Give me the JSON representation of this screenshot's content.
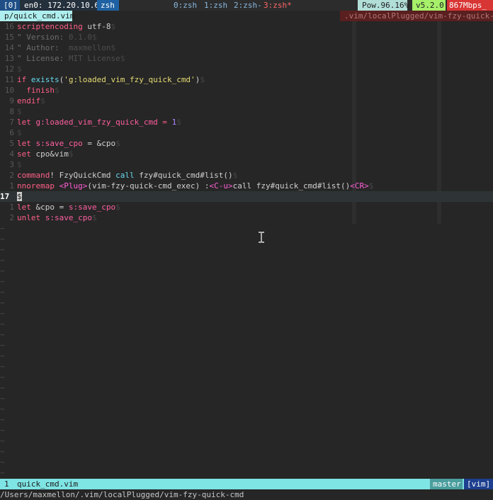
{
  "tmux": {
    "session": "[0]",
    "ip": "en0: 172.20.10.6",
    "current": "zsh",
    "windows": [
      "0:zsh",
      "1:zsh",
      "2:zsh-",
      "3:zsh*"
    ],
    "power": "Pow.96.16%",
    "version": "v5.2.0",
    "network": "867Mbps_"
  },
  "vim": {
    "tab_file": "p/quick_cmd.vim",
    "tab_path": ".vim/localPlugged/vim-fzy-quick-cde",
    "eol_char": "$",
    "tilde": "~",
    "lines": [
      {
        "num": "16",
        "tokens": [
          {
            "t": "scriptencoding ",
            "c": "kw"
          },
          {
            "t": "utf-8",
            "c": ""
          }
        ]
      },
      {
        "num": "15",
        "tokens": [
          {
            "t": "\" Version: ",
            "c": "cm"
          },
          {
            "t": "0.1.0",
            "c": "cmv"
          }
        ]
      },
      {
        "num": "14",
        "tokens": [
          {
            "t": "\" Author:  ",
            "c": "cm"
          },
          {
            "t": "maxmellon",
            "c": "cmv"
          }
        ]
      },
      {
        "num": "13",
        "tokens": [
          {
            "t": "\" License: ",
            "c": "cm"
          },
          {
            "t": "MIT License",
            "c": "cmv"
          }
        ]
      },
      {
        "num": "12",
        "tokens": []
      },
      {
        "num": "11",
        "tokens": [
          {
            "t": "if ",
            "c": "kw"
          },
          {
            "t": "exists",
            "c": "fn"
          },
          {
            "t": "(",
            "c": ""
          },
          {
            "t": "'g:loaded_vim_fzy_quick_cmd'",
            "c": "str"
          },
          {
            "t": ")",
            "c": ""
          }
        ]
      },
      {
        "num": "10",
        "tokens": [
          {
            "t": "  finish",
            "c": "kw"
          }
        ]
      },
      {
        "num": "9",
        "tokens": [
          {
            "t": "endif",
            "c": "kw"
          }
        ]
      },
      {
        "num": "8",
        "tokens": []
      },
      {
        "num": "7",
        "tokens": [
          {
            "t": "let ",
            "c": "kw"
          },
          {
            "t": "g:loaded_vim_fzy_quick_cmd",
            "c": "var"
          },
          {
            "t": " = ",
            "c": "kw"
          },
          {
            "t": "1",
            "c": "num"
          }
        ]
      },
      {
        "num": "6",
        "tokens": []
      },
      {
        "num": "5",
        "tokens": [
          {
            "t": "let ",
            "c": "kw"
          },
          {
            "t": "s:save_cpo",
            "c": "var"
          },
          {
            "t": " = &cpo",
            "c": ""
          }
        ]
      },
      {
        "num": "4",
        "tokens": [
          {
            "t": "set ",
            "c": "kw"
          },
          {
            "t": "cpo&vim",
            "c": ""
          }
        ]
      },
      {
        "num": "3",
        "tokens": []
      },
      {
        "num": "2",
        "tokens": [
          {
            "t": "command",
            "c": "kw"
          },
          {
            "t": "! FzyQuickCmd ",
            "c": ""
          },
          {
            "t": "call ",
            "c": "fn"
          },
          {
            "t": "fzy#quick_cmd#list()",
            "c": ""
          }
        ]
      },
      {
        "num": "1",
        "tokens": [
          {
            "t": "nnoremap ",
            "c": "kw"
          },
          {
            "t": "<Plug>",
            "c": "ang"
          },
          {
            "t": "(vim-fzy-quick-cmd_exec) :",
            "c": ""
          },
          {
            "t": "<C-u>",
            "c": "ang"
          },
          {
            "t": "call fzy#quick_cmd#list()",
            "c": ""
          },
          {
            "t": "<CR>",
            "c": "ang"
          }
        ]
      },
      {
        "num": "17",
        "current": true,
        "tokens": []
      },
      {
        "num": "1",
        "tokens": [
          {
            "t": "let ",
            "c": "kw"
          },
          {
            "t": "&cpo = ",
            "c": ""
          },
          {
            "t": "s:save_cpo",
            "c": "var"
          }
        ]
      },
      {
        "num": "2",
        "tokens": [
          {
            "t": "unlet ",
            "c": "kw"
          },
          {
            "t": "s:save_cpo",
            "c": "var"
          }
        ]
      }
    ],
    "tilde_count": 24
  },
  "statusline": {
    "bufnum": "1",
    "file": "quick_cmd.vim",
    "branch": "master",
    "filetype": "[vim]"
  },
  "cmdline": "/Users/maxmellon/.vim/localPlugged/vim-fzy-quick-cmd"
}
